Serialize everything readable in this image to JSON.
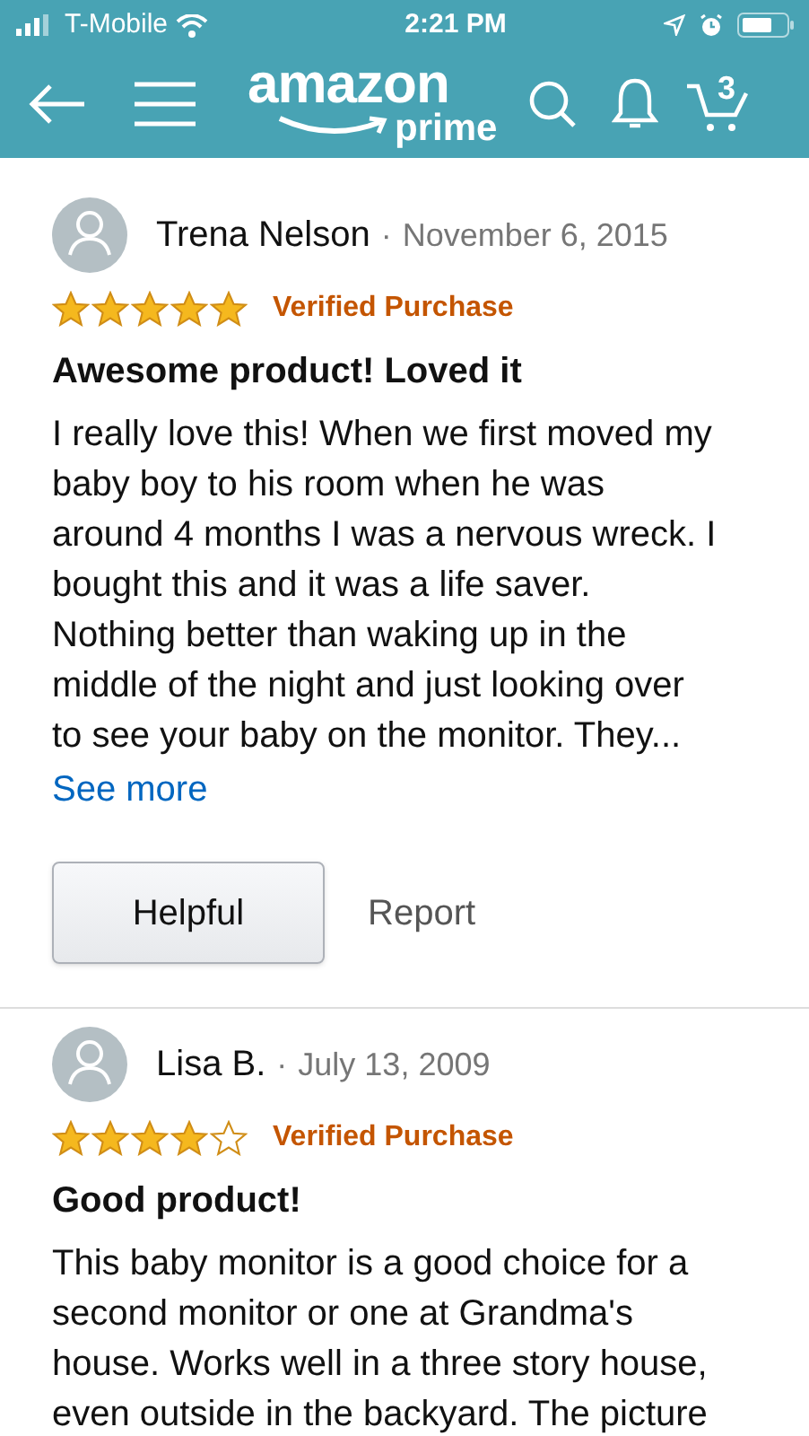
{
  "status_bar": {
    "carrier": "T-Mobile",
    "time": "2:21 PM"
  },
  "header": {
    "logo_word": "amazon",
    "logo_sub": "prime",
    "cart_count": "3"
  },
  "reviews": [
    {
      "author": "Trena Nelson",
      "separator": "·",
      "date": "November 6, 2015",
      "stars": 5,
      "badge": "Verified Purchase",
      "title": "Awesome product! Loved it",
      "body": "I really love this! When we first moved my baby boy to his room when he was around 4 months I was a nervous wreck. I bought this and it was a life saver. Nothing better than waking up in the middle of the night and just looking over to see your baby on the monitor. They...",
      "see_more": "See more",
      "actions": [
        "Helpful",
        "Report"
      ]
    },
    {
      "author": "Lisa B.",
      "separator": "·",
      "date": "July 13, 2009",
      "stars": 4,
      "badge": "Verified Purchase",
      "title": "Good product!",
      "body": "This baby monitor is a good choice for a second monitor or one at Grandma's house. Works well in a three story house, even outside in the backyard. The picture"
    }
  ]
}
